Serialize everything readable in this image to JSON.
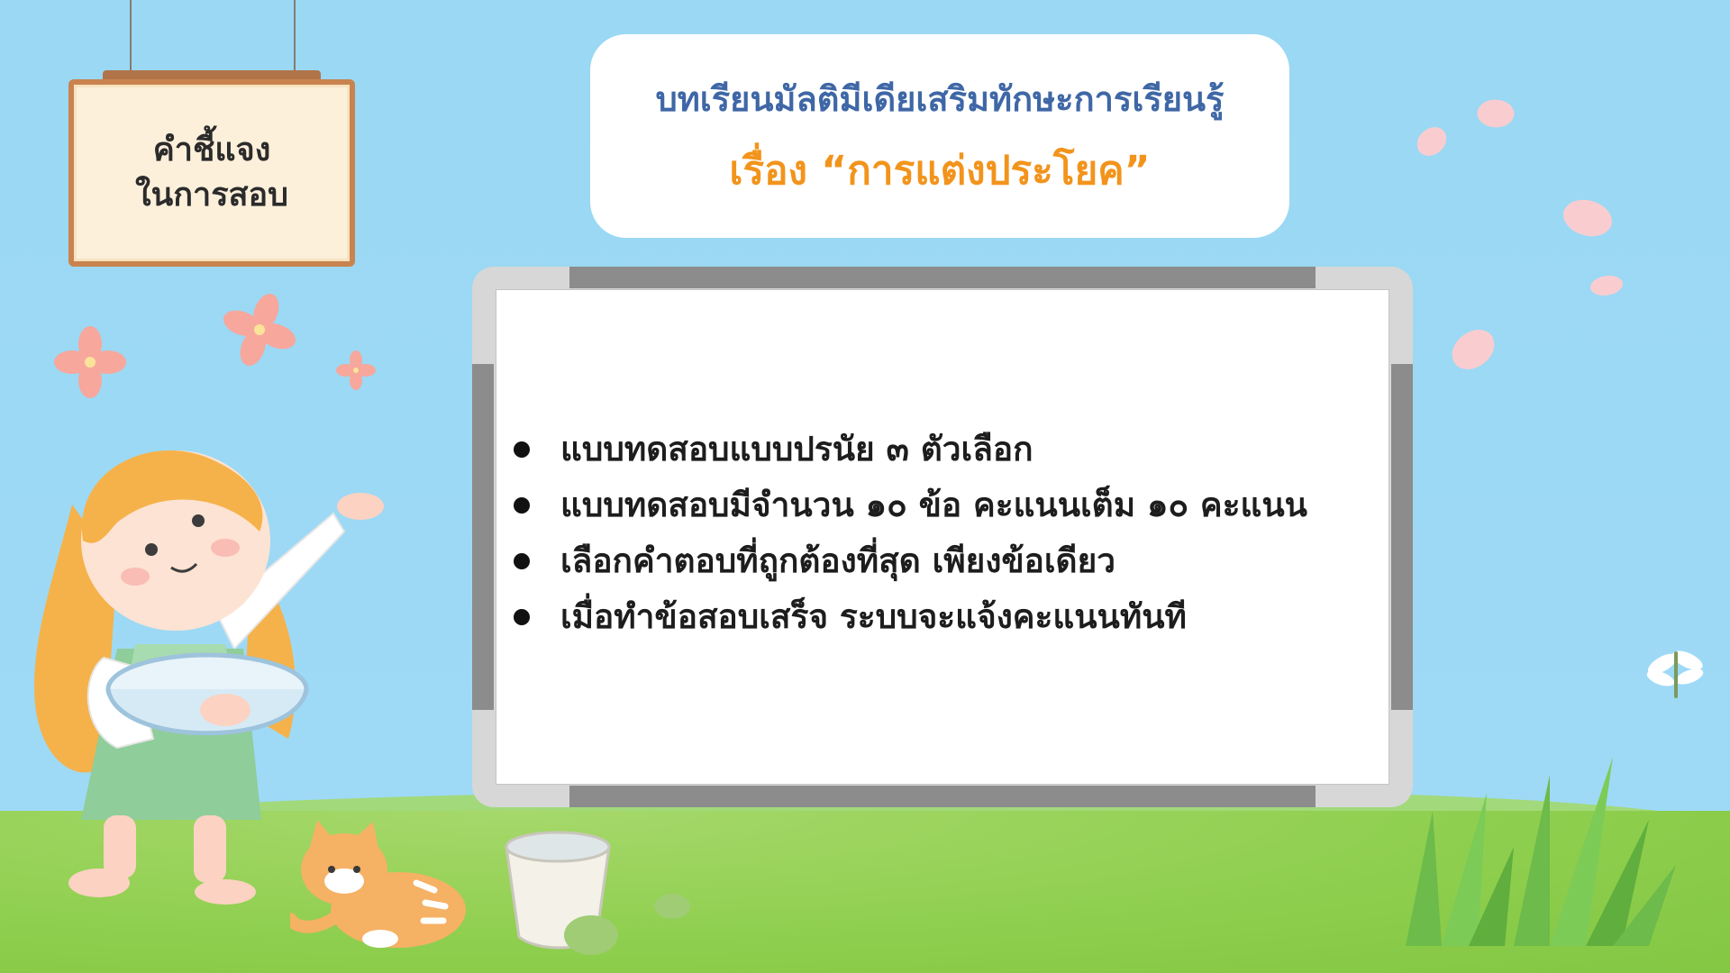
{
  "sign": {
    "text": "คำชี้แจง\nในการสอบ"
  },
  "title": {
    "line1": "บทเรียนมัลติมีเดียเสริมทักษะการเรียนรู้",
    "line2": "เรื่อง “การแต่งประโยค”"
  },
  "instructions": [
    "แบบทดสอบแบบปรนัย  ๓  ตัวเลือก",
    "แบบทดสอบมีจำนวน  ๑๐ ข้อ  คะแนนเต็ม  ๑๐ คะแนน",
    "เลือกคำตอบที่ถูกต้องที่สุด เพียงข้อเดียว",
    "เมื่อทำข้อสอบเสร็จ ระบบจะแจ้งคะแนนทันที"
  ],
  "colors": {
    "sky": "#9ad8f4",
    "grass": "#8fcf4f",
    "title_blue": "#3f67a6",
    "title_orange": "#f2941c",
    "sign_border": "#c9834f"
  },
  "icons": [
    "flower-icon",
    "petal-icon",
    "girl-illustration",
    "cat-illustration",
    "bucket-illustration",
    "dragonfly-icon",
    "grass-tuft-icon"
  ]
}
